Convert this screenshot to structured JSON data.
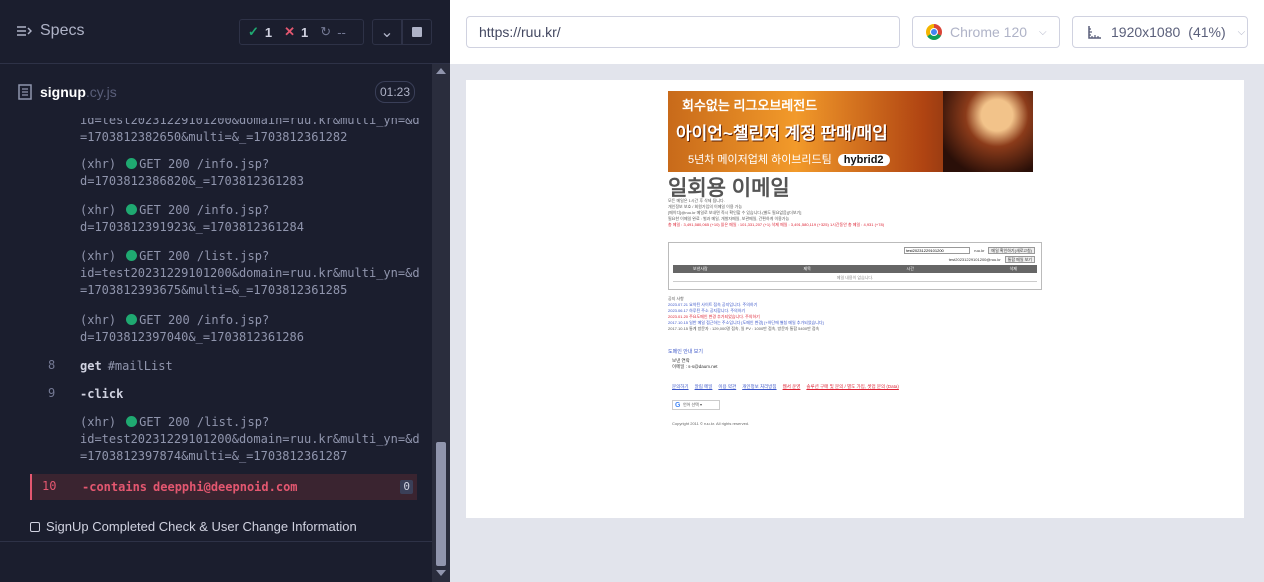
{
  "reporter": {
    "title": "Specs",
    "stats": {
      "passed": "1",
      "failed": "1",
      "pending": "--"
    },
    "spec_file": {
      "name": "signup",
      "ext": ".cy.js",
      "duration": "01:23"
    }
  },
  "commands": [
    {
      "kind": "xhr-cont",
      "lines": [
        "id=test20231229101200&domain=ruu.kr&multi_yn=&d",
        "=1703812382650&multi=&_=1703812361282"
      ]
    },
    {
      "kind": "xhr",
      "prefix": "(xhr)",
      "method": "GET 200 /info.jsp?",
      "cont": "d=1703812386820&_=1703812361283"
    },
    {
      "kind": "xhr",
      "prefix": "(xhr)",
      "method": "GET 200 /info.jsp?",
      "cont": "d=1703812391923&_=1703812361284"
    },
    {
      "kind": "xhr",
      "prefix": "(xhr)",
      "method": "GET 200 /list.jsp?",
      "cont": "id=test20231229101200&domain=ruu.kr&multi_yn=&d",
      "cont2": "=1703812393675&multi=&_=1703812361285"
    },
    {
      "kind": "xhr",
      "prefix": "(xhr)",
      "method": "GET 200 /info.jsp?",
      "cont": "d=1703812397040&_=1703812361286"
    },
    {
      "kind": "cmd",
      "num": "8",
      "name": "get",
      "arg": "#mailList"
    },
    {
      "kind": "cmd",
      "num": "9",
      "name": "-click",
      "arg": ""
    },
    {
      "kind": "xhr",
      "prefix": "(xhr)",
      "method": "GET 200 /list.jsp?",
      "cont": "id=test20231229101200&domain=ruu.kr&multi_yn=&d",
      "cont2": "=1703812397874&multi=&_=1703812361287"
    },
    {
      "kind": "failed",
      "num": "10",
      "name": "-contains",
      "arg": "deepphi@deepnoid.com",
      "badge": "0"
    }
  ],
  "suite": {
    "label": "SignUp Completed Check & User Change Information"
  },
  "aut": {
    "url": "https://ruu.kr/",
    "browser": "Chrome 120",
    "viewport": "1920x1080",
    "scale": "(41%)"
  },
  "site": {
    "banner": {
      "top": "회수없는 리그오브레전드",
      "mid": "아이언~챌린저 계정 판매/매입",
      "bottom": "5년차 메이저업체 하이브리드팀",
      "kakao": "hybrid2"
    },
    "title": "일회용 이메일",
    "info_lines": [
      "모든 메일은 1시간 후 삭제 됩니다.",
      "개인정보 보호 / 회원가입의 이메일 이용 가능",
      "[메이디]@ruu.kr 메일로 보내면 즉시 확인할 수 있습니다.(별도 필요없음)[더보기]",
      "필요한 이메일 완료 : 벌과 메일, 개발자메일, 보관메일, 간편하게 이용가능",
      "총 메일 : 3,491,580,065 (+10) 읽은 메일 : 101,331,207 (+1) 삭제 메일 : 3,491,580,119 (+325) 1시간동안 총 메일 : 4,931 (+78)"
    ],
    "mail_panel": {
      "input_value": "test20231229101200",
      "domain": "ruu.kr",
      "btn1": "메일 확인하기(새로고침)",
      "btn2": "통합 메일 보기",
      "address": "test20231229101200@ruu.kr",
      "col_from": "보낸사람",
      "col_subject": "제목",
      "col_time": "시간",
      "col_delete": "삭제",
      "empty": "메일 내용이 없습니다."
    },
    "notices": [
      {
        "text": "공지 사항",
        "style": ""
      },
      {
        "text": "2023.07.21 요약된 사이트 접속 공지입니다. 주의하기",
        "style": "blue"
      },
      {
        "text": "2023.06.17 하루된 주소 공지합니다. 주의하기",
        "style": "blue"
      },
      {
        "text": "2023.01.20 주요도메인 변경 추가되었습니다. 주의하기",
        "style": "red"
      },
      {
        "text": "2017.10.15 일반 메일 접근하는 주소입니다 [도메인 변경] [+하단에 별칭 메일 추가되었습니다]",
        "style": "blue"
      },
      {
        "text": "2017.10.15 통계 방문자 : 129,000명 접속, 일 PV : 1000만 접속, 방문자 통합 5400만 접속",
        "style": ""
      }
    ],
    "more_link": "도메인 안내 보기",
    "addr_title": "보낸 연락",
    "addr_value": "이메일 : s-s@daum.net",
    "footer_links": [
      {
        "text": "문의하기",
        "red": false
      },
      {
        "text": "알림 메일",
        "red": false
      },
      {
        "text": "이용 약관",
        "red": false
      },
      {
        "text": "개인정보 처리방침",
        "red": false
      },
      {
        "text": "웹서 운영",
        "red": true
      },
      {
        "text": "솔루션 구매 및 문의 / 별도 가입, 셋업 문의 (Data)",
        "red": true
      }
    ],
    "translate": "언어 선택",
    "copyright": "Copyright 2011 © ruu.kr. All rights reserved."
  },
  "colors": {
    "pass": "#1fa971",
    "fail": "#e45770",
    "reporter_bg": "#1b1e2e"
  }
}
